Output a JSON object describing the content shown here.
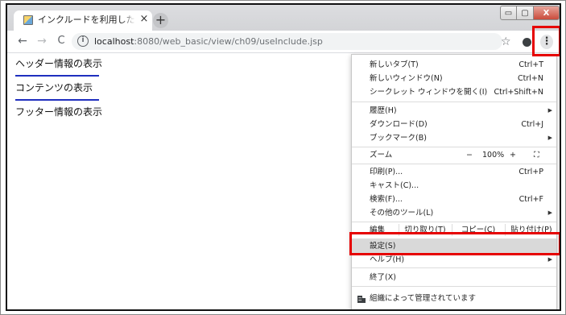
{
  "tab": {
    "title": "インクルードを利用したプログラ",
    "close": "×",
    "new_tab": "+"
  },
  "window": {
    "min": "▭",
    "max": "▢",
    "close": "X"
  },
  "toolbar": {
    "back": "←",
    "forward": "→",
    "reload": "C",
    "info": "i",
    "url_host": "localhost",
    "url_path": ":8080/web_basic/view/ch09/useInclude.jsp",
    "star": "☆",
    "menu": "⋮"
  },
  "content": {
    "header_text": "ヘッダー情報の表示",
    "contents_text": "コンテンツの表示",
    "footer_text": "フッター情報の表示"
  },
  "menu": {
    "new_tab": {
      "label": "新しいタブ(T)",
      "shortcut": "Ctrl+T"
    },
    "new_window": {
      "label": "新しいウィンドウ(N)",
      "shortcut": "Ctrl+N"
    },
    "incognito": {
      "label": "シークレット ウィンドウを開く(I)",
      "shortcut": "Ctrl+Shift+N"
    },
    "history": {
      "label": "履歴(H)"
    },
    "downloads": {
      "label": "ダウンロード(D)",
      "shortcut": "Ctrl+J"
    },
    "bookmarks": {
      "label": "ブックマーク(B)"
    },
    "zoom": {
      "label": "ズーム",
      "minus": "−",
      "level": "100%",
      "plus": "+",
      "fullscreen": "⛶"
    },
    "print": {
      "label": "印刷(P)...",
      "shortcut": "Ctrl+P"
    },
    "cast": {
      "label": "キャスト(C)..."
    },
    "find": {
      "label": "検索(F)...",
      "shortcut": "Ctrl+F"
    },
    "more_tools": {
      "label": "その他のツール(L)"
    },
    "edit": {
      "label": "編集",
      "cut": "切り取り(T)",
      "copy": "コピー(C)",
      "paste": "貼り付け(P)"
    },
    "settings": {
      "label": "設定(S)"
    },
    "help": {
      "label": "ヘルプ(H)"
    },
    "exit": {
      "label": "終了(X)"
    },
    "managed": {
      "label": "組織によって管理されています"
    }
  },
  "colors": {
    "highlight": "#e60000",
    "rule": "#1f2fbf",
    "menu_hover": "#d9d9d9"
  }
}
